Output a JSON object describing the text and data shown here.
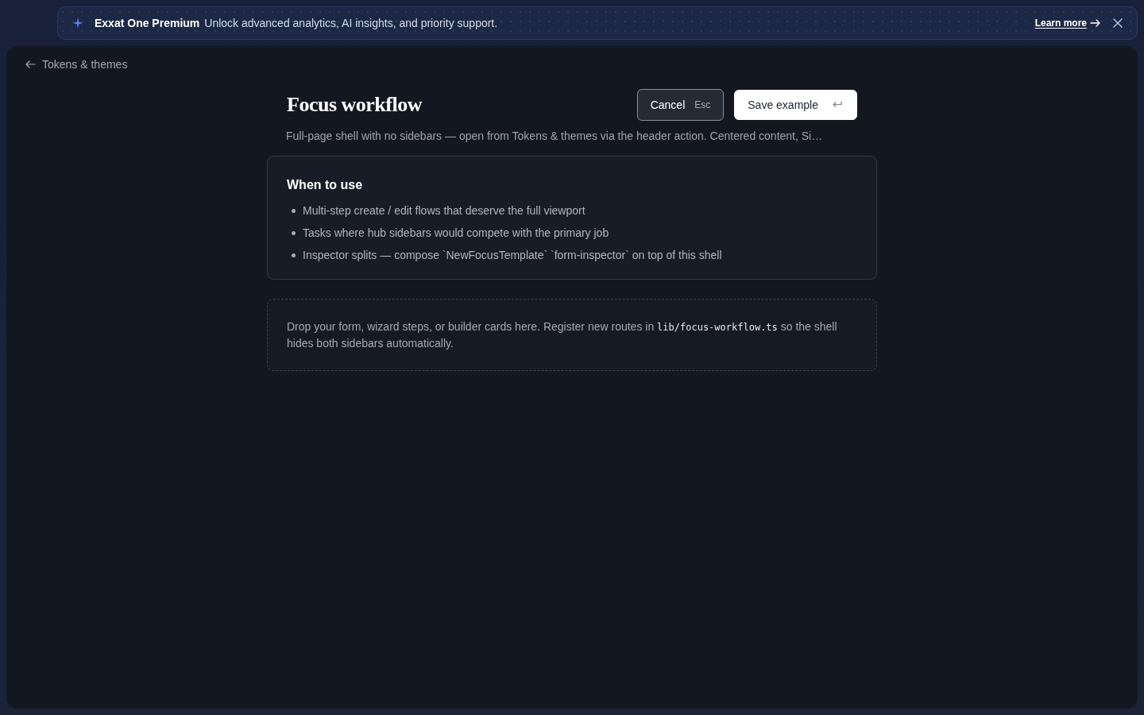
{
  "banner": {
    "title": "Exxat One Premium",
    "message": "Unlock advanced analytics, AI insights, and priority support.",
    "link": "Learn more"
  },
  "back_link": "Tokens & themes",
  "header": {
    "title": "Focus workflow",
    "subtitle": "Full-page shell with no sidebars — open from Tokens & themes via the header action. Centered content, Si…",
    "buttons": [
      {
        "kind": "secondary",
        "label": "Cancel",
        "shortcut": "Esc"
      },
      {
        "kind": "primary",
        "label": "Save example"
      }
    ]
  },
  "usage_card": {
    "title": "When to use",
    "items": [
      "Multi-step create / edit flows that deserve the full viewport",
      "Tasks where hub sidebars would compete with the primary job",
      "Inspector splits — compose `NewFocusTemplate` `form-inspector` on top of this shell"
    ]
  },
  "drop_zone": {
    "text": [
      {
        "kind": "text",
        "text": "Drop your form, wizard steps, or builder cards here. Register new routes in "
      },
      {
        "kind": "code",
        "text": "lib/focus-workflow.ts"
      },
      {
        "kind": "text",
        "text": " so the shell hides both sidebars automatically."
      }
    ]
  }
}
